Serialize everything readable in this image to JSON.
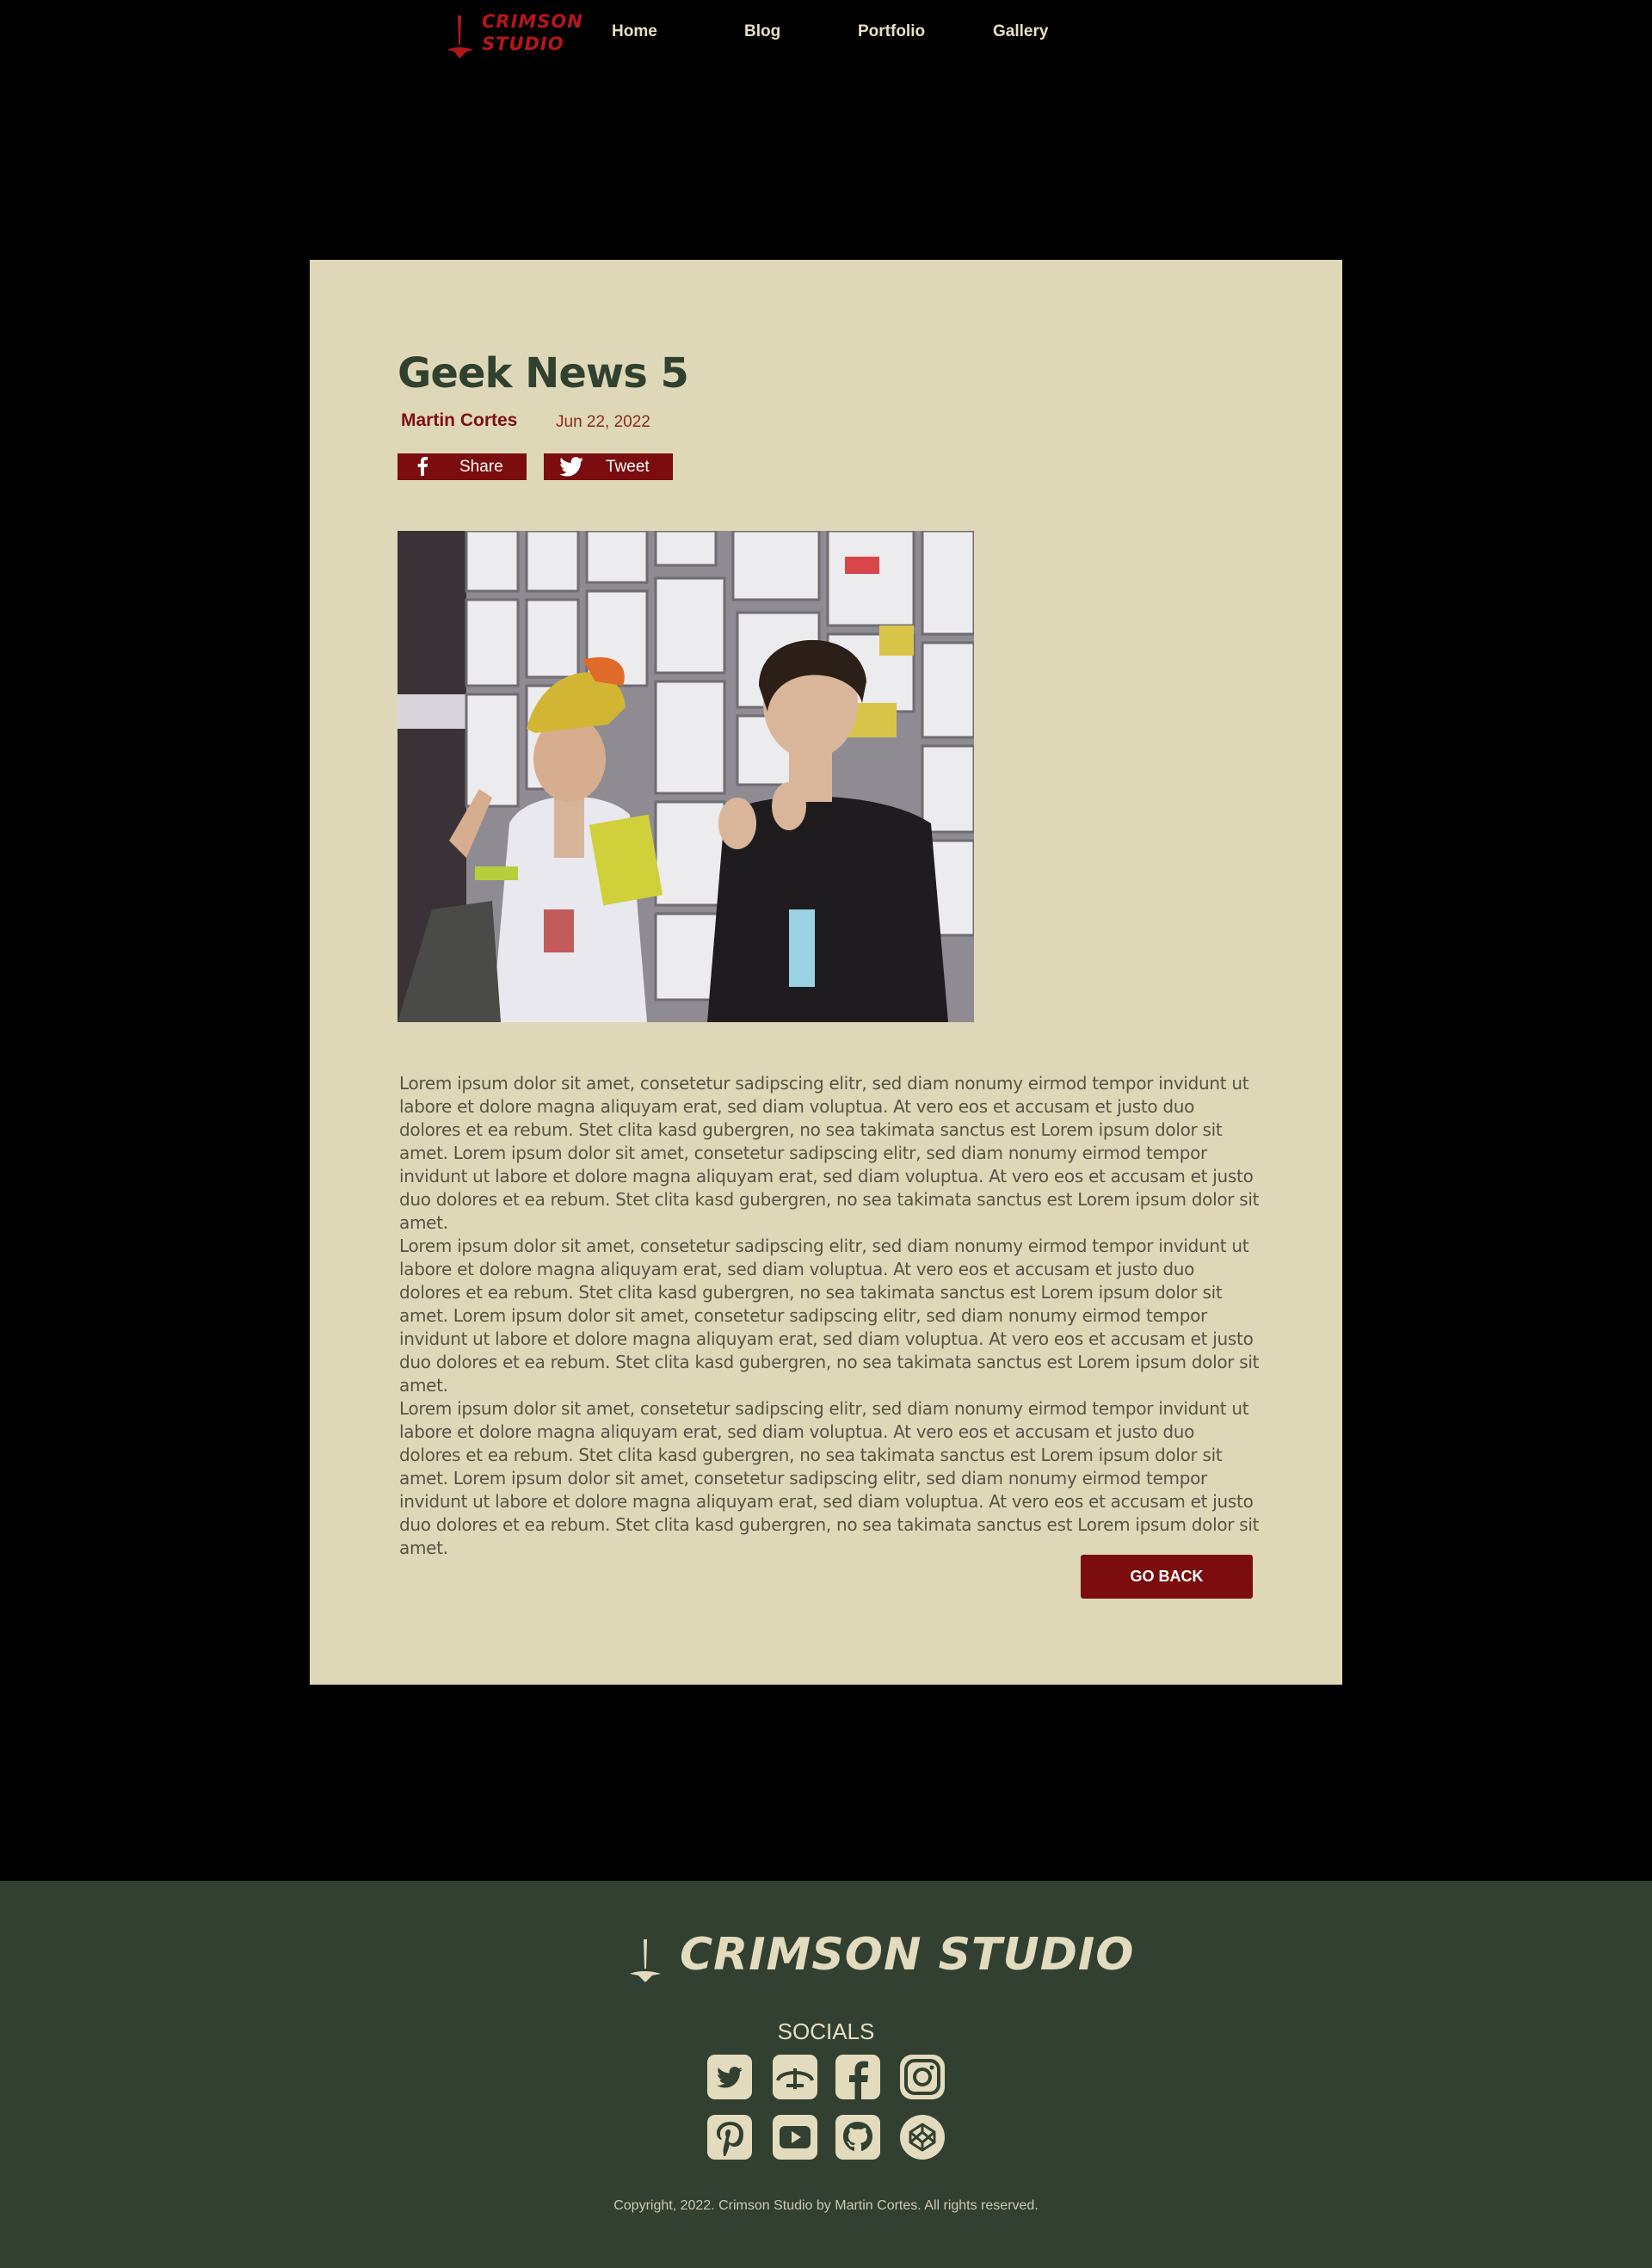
{
  "nav": {
    "logo_line1": "CRIMSON",
    "logo_line2": "STUDIO",
    "links": [
      "Home",
      "Blog",
      "Portfolio",
      "Gallery"
    ]
  },
  "article": {
    "title": "Geek News 5",
    "author": "Martin Cortes",
    "date": "Jun 22, 2022",
    "share_label": "Share",
    "tweet_label": "Tweet",
    "paragraphs": [
      "Lorem ipsum dolor sit amet, consetetur sadipscing elitr, sed diam nonumy eirmod tempor invidunt ut labore et dolore magna aliquyam erat, sed diam voluptua. At vero eos et accusam et justo duo dolores et ea rebum. Stet clita kasd gubergren, no sea takimata sanctus est Lorem ipsum dolor sit amet. Lorem ipsum dolor sit amet, consetetur sadipscing elitr, sed diam nonumy eirmod tempor invidunt ut labore et dolore magna aliquyam erat, sed diam voluptua. At vero eos et accusam et justo duo dolores et ea rebum. Stet clita kasd gubergren, no sea takimata sanctus est Lorem ipsum dolor sit amet.",
      "Lorem ipsum dolor sit amet, consetetur sadipscing elitr, sed diam nonumy eirmod tempor invidunt ut labore et dolore magna aliquyam erat, sed diam voluptua. At vero eos et accusam et justo duo dolores et ea rebum. Stet clita kasd gubergren, no sea takimata sanctus est Lorem ipsum dolor sit amet. Lorem ipsum dolor sit amet, consetetur sadipscing elitr, sed diam nonumy eirmod tempor invidunt ut labore et dolore magna aliquyam erat, sed diam voluptua. At vero eos et accusam et justo duo dolores et ea rebum. Stet clita kasd gubergren, no sea takimata sanctus est Lorem ipsum dolor sit amet.",
      "Lorem ipsum dolor sit amet, consetetur sadipscing elitr, sed diam nonumy eirmod tempor invidunt ut labore et dolore magna aliquyam erat, sed diam voluptua. At vero eos et accusam et justo duo dolores et ea rebum. Stet clita kasd gubergren, no sea takimata sanctus est Lorem ipsum dolor sit amet. Lorem ipsum dolor sit amet, consetetur sadipscing elitr, sed diam nonumy eirmod tempor invidunt ut labore et dolore magna aliquyam erat, sed diam voluptua. At vero eos et accusam et justo duo dolores et ea rebum. Stet clita kasd gubergren, no sea takimata sanctus est Lorem ipsum dolor sit amet."
    ],
    "go_back_label": "GO BACK"
  },
  "footer": {
    "logo_text": "CRIMSON STUDIO",
    "socials_title": "SOCIALS",
    "social_icons": [
      "twitter-icon",
      "deviantart-icon",
      "facebook-icon",
      "instagram-icon",
      "pinterest-icon",
      "youtube-icon",
      "github-icon",
      "codepen-icon"
    ],
    "copyright": "Copyright, 2022. Crimson Studio by Martin Cortes. All rights reserved."
  },
  "colors": {
    "background": "#000000",
    "card": "#dfd8b8",
    "accent": "#7b0d0f",
    "title": "#314130",
    "footer": "#324031",
    "footer_text": "#e3dbbd"
  }
}
